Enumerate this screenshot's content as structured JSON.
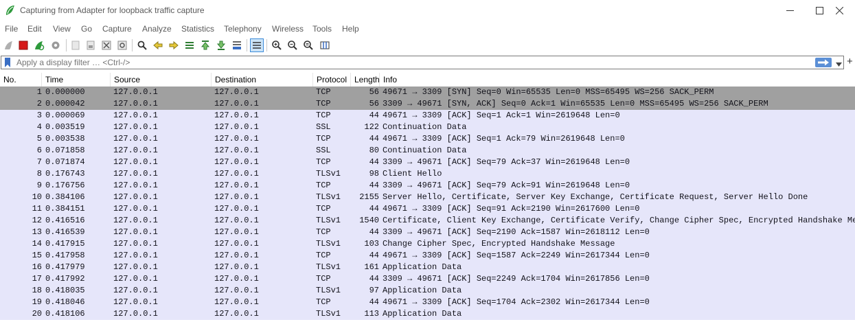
{
  "window": {
    "title": "Capturing from Adapter for loopback traffic capture"
  },
  "menu": [
    "File",
    "Edit",
    "View",
    "Go",
    "Capture",
    "Analyze",
    "Statistics",
    "Telephony",
    "Wireless",
    "Tools",
    "Help"
  ],
  "filter": {
    "placeholder": "Apply a display filter … <Ctrl-/>"
  },
  "columns": {
    "no": "No.",
    "time": "Time",
    "source": "Source",
    "destination": "Destination",
    "protocol": "Protocol",
    "length": "Length",
    "info": "Info"
  },
  "colors": {
    "row_bg": "#e6e6fa",
    "row_selected_bg": "#a0a0a0",
    "accent": "#5b8fd6"
  },
  "packets": [
    {
      "no": "1",
      "time": "0.000000",
      "src": "127.0.0.1",
      "dst": "127.0.0.1",
      "proto": "TCP",
      "len": "56",
      "info": "49671 → 3309 [SYN] Seq=0 Win=65535 Len=0 MSS=65495 WS=256 SACK_PERM",
      "selected": true
    },
    {
      "no": "2",
      "time": "0.000042",
      "src": "127.0.0.1",
      "dst": "127.0.0.1",
      "proto": "TCP",
      "len": "56",
      "info": "3309 → 49671 [SYN, ACK] Seq=0 Ack=1 Win=65535 Len=0 MSS=65495 WS=256 SACK_PERM",
      "selected": true
    },
    {
      "no": "3",
      "time": "0.000069",
      "src": "127.0.0.1",
      "dst": "127.0.0.1",
      "proto": "TCP",
      "len": "44",
      "info": "49671 → 3309 [ACK] Seq=1 Ack=1 Win=2619648 Len=0"
    },
    {
      "no": "4",
      "time": "0.003519",
      "src": "127.0.0.1",
      "dst": "127.0.0.1",
      "proto": "SSL",
      "len": "122",
      "info": "Continuation Data"
    },
    {
      "no": "5",
      "time": "0.003538",
      "src": "127.0.0.1",
      "dst": "127.0.0.1",
      "proto": "TCP",
      "len": "44",
      "info": "49671 → 3309 [ACK] Seq=1 Ack=79 Win=2619648 Len=0"
    },
    {
      "no": "6",
      "time": "0.071858",
      "src": "127.0.0.1",
      "dst": "127.0.0.1",
      "proto": "SSL",
      "len": "80",
      "info": "Continuation Data"
    },
    {
      "no": "7",
      "time": "0.071874",
      "src": "127.0.0.1",
      "dst": "127.0.0.1",
      "proto": "TCP",
      "len": "44",
      "info": "3309 → 49671 [ACK] Seq=79 Ack=37 Win=2619648 Len=0"
    },
    {
      "no": "8",
      "time": "0.176743",
      "src": "127.0.0.1",
      "dst": "127.0.0.1",
      "proto": "TLSv1",
      "len": "98",
      "info": "Client Hello"
    },
    {
      "no": "9",
      "time": "0.176756",
      "src": "127.0.0.1",
      "dst": "127.0.0.1",
      "proto": "TCP",
      "len": "44",
      "info": "3309 → 49671 [ACK] Seq=79 Ack=91 Win=2619648 Len=0"
    },
    {
      "no": "10",
      "time": "0.384106",
      "src": "127.0.0.1",
      "dst": "127.0.0.1",
      "proto": "TLSv1",
      "len": "2155",
      "info": "Server Hello, Certificate, Server Key Exchange, Certificate Request, Server Hello Done"
    },
    {
      "no": "11",
      "time": "0.384151",
      "src": "127.0.0.1",
      "dst": "127.0.0.1",
      "proto": "TCP",
      "len": "44",
      "info": "49671 → 3309 [ACK] Seq=91 Ack=2190 Win=2617600 Len=0"
    },
    {
      "no": "12",
      "time": "0.416516",
      "src": "127.0.0.1",
      "dst": "127.0.0.1",
      "proto": "TLSv1",
      "len": "1540",
      "info": "Certificate, Client Key Exchange, Certificate Verify, Change Cipher Spec, Encrypted Handshake Me…"
    },
    {
      "no": "13",
      "time": "0.416539",
      "src": "127.0.0.1",
      "dst": "127.0.0.1",
      "proto": "TCP",
      "len": "44",
      "info": "3309 → 49671 [ACK] Seq=2190 Ack=1587 Win=2618112 Len=0"
    },
    {
      "no": "14",
      "time": "0.417915",
      "src": "127.0.0.1",
      "dst": "127.0.0.1",
      "proto": "TLSv1",
      "len": "103",
      "info": "Change Cipher Spec, Encrypted Handshake Message"
    },
    {
      "no": "15",
      "time": "0.417958",
      "src": "127.0.0.1",
      "dst": "127.0.0.1",
      "proto": "TCP",
      "len": "44",
      "info": "49671 → 3309 [ACK] Seq=1587 Ack=2249 Win=2617344 Len=0"
    },
    {
      "no": "16",
      "time": "0.417979",
      "src": "127.0.0.1",
      "dst": "127.0.0.1",
      "proto": "TLSv1",
      "len": "161",
      "info": "Application Data"
    },
    {
      "no": "17",
      "time": "0.417992",
      "src": "127.0.0.1",
      "dst": "127.0.0.1",
      "proto": "TCP",
      "len": "44",
      "info": "3309 → 49671 [ACK] Seq=2249 Ack=1704 Win=2617856 Len=0"
    },
    {
      "no": "18",
      "time": "0.418035",
      "src": "127.0.0.1",
      "dst": "127.0.0.1",
      "proto": "TLSv1",
      "len": "97",
      "info": "Application Data"
    },
    {
      "no": "19",
      "time": "0.418046",
      "src": "127.0.0.1",
      "dst": "127.0.0.1",
      "proto": "TCP",
      "len": "44",
      "info": "49671 → 3309 [ACK] Seq=1704 Ack=2302 Win=2617344 Len=0"
    },
    {
      "no": "20",
      "time": "0.418106",
      "src": "127.0.0.1",
      "dst": "127.0.0.1",
      "proto": "TLSv1",
      "len": "113",
      "info": "Application Data"
    }
  ]
}
